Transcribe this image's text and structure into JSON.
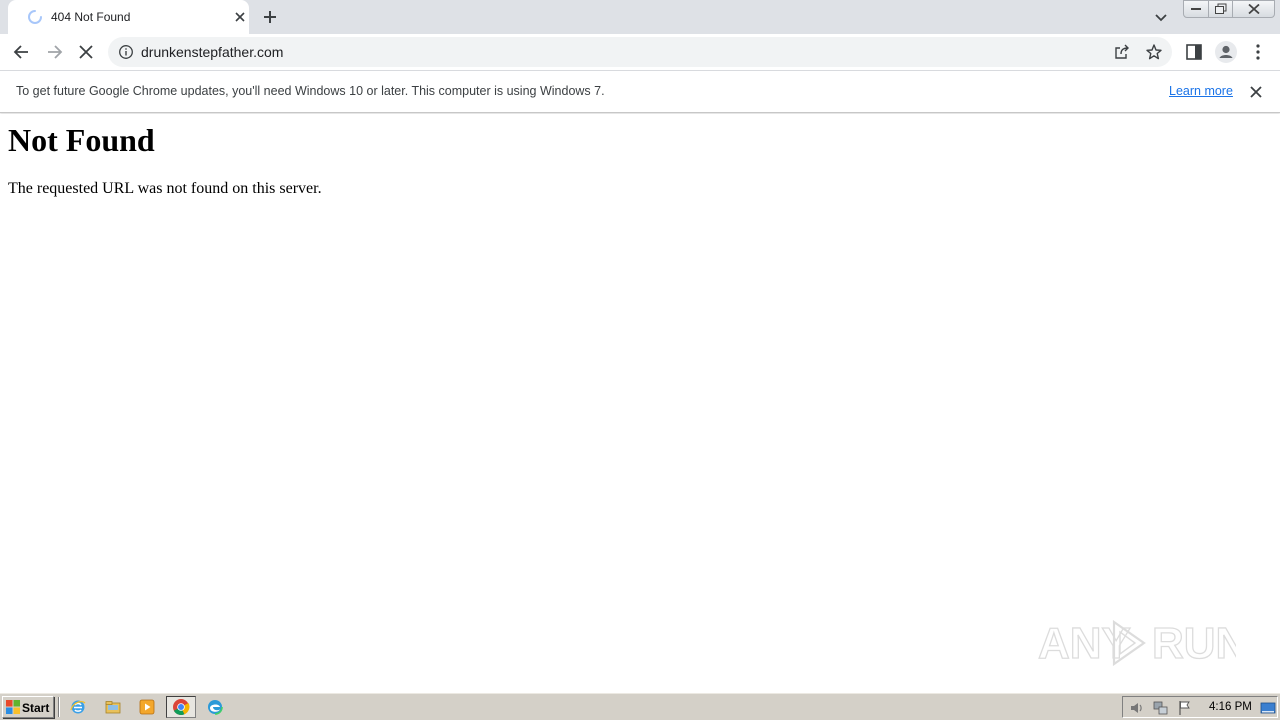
{
  "browser": {
    "tab": {
      "title": "404 Not Found"
    },
    "toolbar": {
      "url": "drunkenstepfather.com"
    },
    "infobar": {
      "message": "To get future Google Chrome updates, you'll need Windows 10 or later. This computer is using Windows 7.",
      "link_label": "Learn more"
    }
  },
  "page": {
    "heading": "Not Found",
    "message": "The requested URL was not found on this server."
  },
  "watermark": {
    "text": "ANY RUN"
  },
  "taskbar": {
    "start_label": "Start",
    "clock": "4:16 PM"
  },
  "colors": {
    "tabstrip": "#dee1e6",
    "omnibox": "#f1f3f4",
    "link": "#1a73e8",
    "taskbar": "#d4d0c8"
  }
}
